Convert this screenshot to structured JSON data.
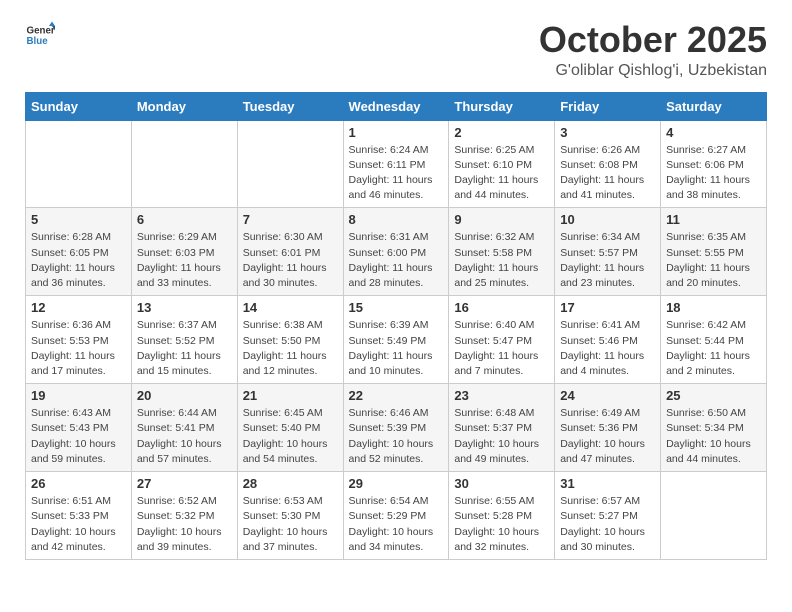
{
  "logo": {
    "general": "General",
    "blue": "Blue"
  },
  "header": {
    "month": "October 2025",
    "location": "G'oliblar Qishlog'i, Uzbekistan"
  },
  "weekdays": [
    "Sunday",
    "Monday",
    "Tuesday",
    "Wednesday",
    "Thursday",
    "Friday",
    "Saturday"
  ],
  "weeks": [
    [
      {
        "day": "",
        "info": ""
      },
      {
        "day": "",
        "info": ""
      },
      {
        "day": "",
        "info": ""
      },
      {
        "day": "1",
        "info": "Sunrise: 6:24 AM\nSunset: 6:11 PM\nDaylight: 11 hours\nand 46 minutes."
      },
      {
        "day": "2",
        "info": "Sunrise: 6:25 AM\nSunset: 6:10 PM\nDaylight: 11 hours\nand 44 minutes."
      },
      {
        "day": "3",
        "info": "Sunrise: 6:26 AM\nSunset: 6:08 PM\nDaylight: 11 hours\nand 41 minutes."
      },
      {
        "day": "4",
        "info": "Sunrise: 6:27 AM\nSunset: 6:06 PM\nDaylight: 11 hours\nand 38 minutes."
      }
    ],
    [
      {
        "day": "5",
        "info": "Sunrise: 6:28 AM\nSunset: 6:05 PM\nDaylight: 11 hours\nand 36 minutes."
      },
      {
        "day": "6",
        "info": "Sunrise: 6:29 AM\nSunset: 6:03 PM\nDaylight: 11 hours\nand 33 minutes."
      },
      {
        "day": "7",
        "info": "Sunrise: 6:30 AM\nSunset: 6:01 PM\nDaylight: 11 hours\nand 30 minutes."
      },
      {
        "day": "8",
        "info": "Sunrise: 6:31 AM\nSunset: 6:00 PM\nDaylight: 11 hours\nand 28 minutes."
      },
      {
        "day": "9",
        "info": "Sunrise: 6:32 AM\nSunset: 5:58 PM\nDaylight: 11 hours\nand 25 minutes."
      },
      {
        "day": "10",
        "info": "Sunrise: 6:34 AM\nSunset: 5:57 PM\nDaylight: 11 hours\nand 23 minutes."
      },
      {
        "day": "11",
        "info": "Sunrise: 6:35 AM\nSunset: 5:55 PM\nDaylight: 11 hours\nand 20 minutes."
      }
    ],
    [
      {
        "day": "12",
        "info": "Sunrise: 6:36 AM\nSunset: 5:53 PM\nDaylight: 11 hours\nand 17 minutes."
      },
      {
        "day": "13",
        "info": "Sunrise: 6:37 AM\nSunset: 5:52 PM\nDaylight: 11 hours\nand 15 minutes."
      },
      {
        "day": "14",
        "info": "Sunrise: 6:38 AM\nSunset: 5:50 PM\nDaylight: 11 hours\nand 12 minutes."
      },
      {
        "day": "15",
        "info": "Sunrise: 6:39 AM\nSunset: 5:49 PM\nDaylight: 11 hours\nand 10 minutes."
      },
      {
        "day": "16",
        "info": "Sunrise: 6:40 AM\nSunset: 5:47 PM\nDaylight: 11 hours\nand 7 minutes."
      },
      {
        "day": "17",
        "info": "Sunrise: 6:41 AM\nSunset: 5:46 PM\nDaylight: 11 hours\nand 4 minutes."
      },
      {
        "day": "18",
        "info": "Sunrise: 6:42 AM\nSunset: 5:44 PM\nDaylight: 11 hours\nand 2 minutes."
      }
    ],
    [
      {
        "day": "19",
        "info": "Sunrise: 6:43 AM\nSunset: 5:43 PM\nDaylight: 10 hours\nand 59 minutes."
      },
      {
        "day": "20",
        "info": "Sunrise: 6:44 AM\nSunset: 5:41 PM\nDaylight: 10 hours\nand 57 minutes."
      },
      {
        "day": "21",
        "info": "Sunrise: 6:45 AM\nSunset: 5:40 PM\nDaylight: 10 hours\nand 54 minutes."
      },
      {
        "day": "22",
        "info": "Sunrise: 6:46 AM\nSunset: 5:39 PM\nDaylight: 10 hours\nand 52 minutes."
      },
      {
        "day": "23",
        "info": "Sunrise: 6:48 AM\nSunset: 5:37 PM\nDaylight: 10 hours\nand 49 minutes."
      },
      {
        "day": "24",
        "info": "Sunrise: 6:49 AM\nSunset: 5:36 PM\nDaylight: 10 hours\nand 47 minutes."
      },
      {
        "day": "25",
        "info": "Sunrise: 6:50 AM\nSunset: 5:34 PM\nDaylight: 10 hours\nand 44 minutes."
      }
    ],
    [
      {
        "day": "26",
        "info": "Sunrise: 6:51 AM\nSunset: 5:33 PM\nDaylight: 10 hours\nand 42 minutes."
      },
      {
        "day": "27",
        "info": "Sunrise: 6:52 AM\nSunset: 5:32 PM\nDaylight: 10 hours\nand 39 minutes."
      },
      {
        "day": "28",
        "info": "Sunrise: 6:53 AM\nSunset: 5:30 PM\nDaylight: 10 hours\nand 37 minutes."
      },
      {
        "day": "29",
        "info": "Sunrise: 6:54 AM\nSunset: 5:29 PM\nDaylight: 10 hours\nand 34 minutes."
      },
      {
        "day": "30",
        "info": "Sunrise: 6:55 AM\nSunset: 5:28 PM\nDaylight: 10 hours\nand 32 minutes."
      },
      {
        "day": "31",
        "info": "Sunrise: 6:57 AM\nSunset: 5:27 PM\nDaylight: 10 hours\nand 30 minutes."
      },
      {
        "day": "",
        "info": ""
      }
    ]
  ]
}
